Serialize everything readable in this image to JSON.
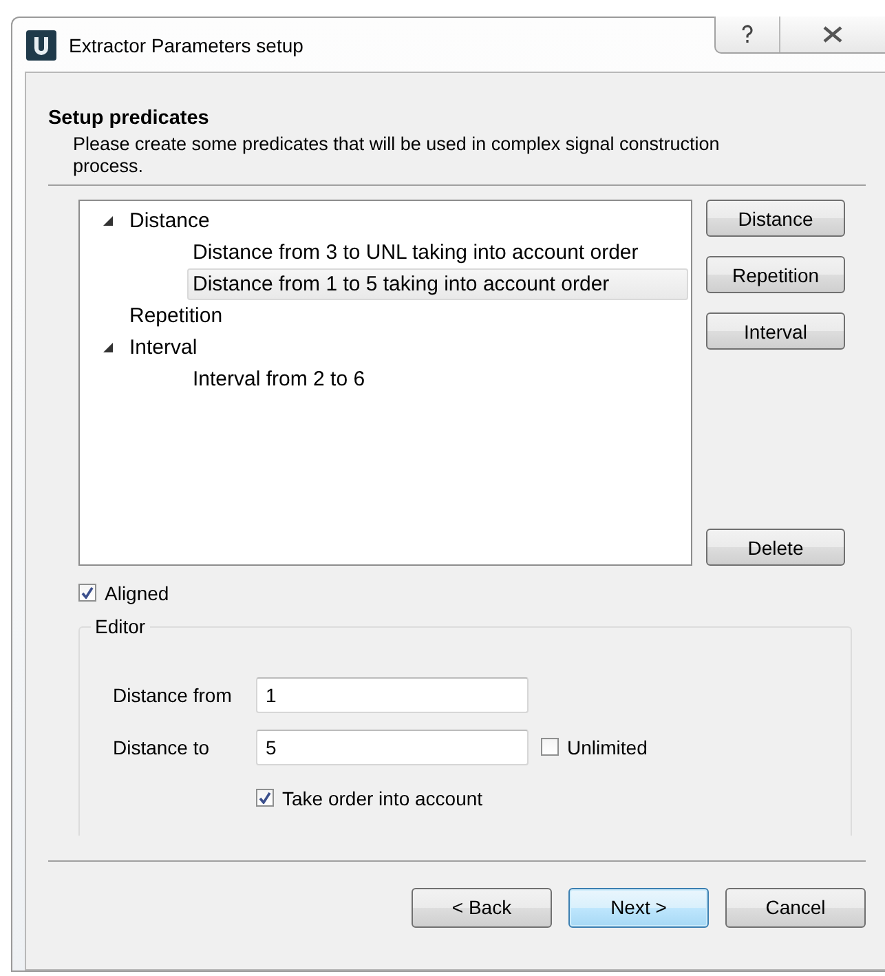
{
  "window": {
    "title": "Extractor Parameters setup"
  },
  "header": {
    "title": "Setup predicates",
    "subtitle": "Please create some predicates that will be used in complex signal construction process."
  },
  "tree": [
    {
      "label": "Distance",
      "expanded": true,
      "selected": false,
      "children": [
        {
          "label": "Distance from 3 to UNL taking into account order",
          "selected": false
        },
        {
          "label": "Distance from 1 to 5 taking into account order",
          "selected": true
        }
      ]
    },
    {
      "label": "Repetition",
      "selected": false
    },
    {
      "label": "Interval",
      "expanded": true,
      "selected": false,
      "children": [
        {
          "label": "Interval from 2 to 6",
          "selected": false
        }
      ]
    }
  ],
  "side_buttons": [
    {
      "label": "Distance",
      "kind": "add"
    },
    {
      "label": "Repetition",
      "kind": "add"
    },
    {
      "label": "Interval",
      "kind": "add"
    },
    {
      "label": "Delete",
      "kind": "delete"
    }
  ],
  "aligned": {
    "label": "Aligned",
    "checked": true
  },
  "editor": {
    "title": "Editor",
    "fields": [
      {
        "label": "Distance from",
        "value": "1"
      },
      {
        "label": "Distance to",
        "value": "5"
      }
    ],
    "unlimited": {
      "label": "Unlimited",
      "checked": false
    },
    "take_order": {
      "label": "Take order into account",
      "checked": true
    }
  },
  "footer_buttons": [
    {
      "label": "< Back",
      "default": false
    },
    {
      "label": "Next >",
      "default": true
    },
    {
      "label": "Cancel",
      "default": false
    }
  ]
}
